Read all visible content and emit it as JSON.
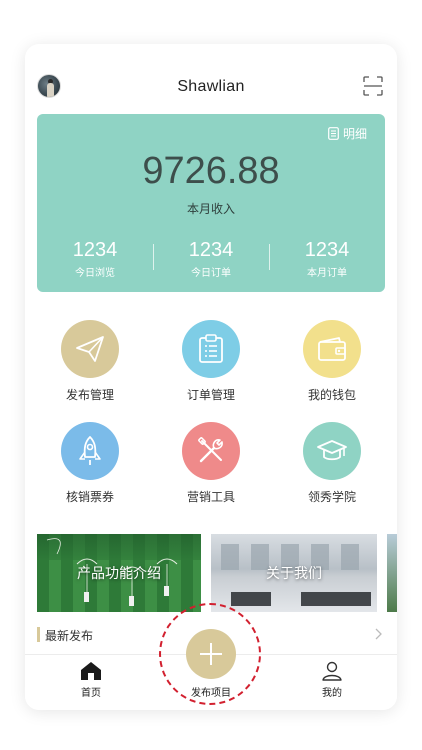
{
  "header": {
    "title": "Shawlian",
    "scan_icon": "scan-icon",
    "avatar_icon": "avatar"
  },
  "card": {
    "detail_label": "明细",
    "amount": "9726.88",
    "amount_label": "本月收入",
    "stats": [
      {
        "value": "1234",
        "label": "今日浏览"
      },
      {
        "value": "1234",
        "label": "今日订单"
      },
      {
        "value": "1234",
        "label": "本月订单"
      }
    ],
    "color": "#8fd3c4"
  },
  "grid": [
    {
      "label": "发布管理",
      "icon": "paper-plane-icon",
      "color": "#d8c99a"
    },
    {
      "label": "订单管理",
      "icon": "clipboard-icon",
      "color": "#7ecde6"
    },
    {
      "label": "我的钱包",
      "icon": "wallet-icon",
      "color": "#f2e08c"
    },
    {
      "label": "核销票券",
      "icon": "rocket-icon",
      "color": "#7bbbe9"
    },
    {
      "label": "营销工具",
      "icon": "tools-icon",
      "color": "#ef8a8a"
    },
    {
      "label": "领秀学院",
      "icon": "graduation-cap-icon",
      "color": "#8fd3c4"
    }
  ],
  "banners": [
    {
      "text": "产品功能介绍"
    },
    {
      "text": "关于我们"
    }
  ],
  "latest": {
    "title": "最新发布"
  },
  "tabbar": {
    "home": "首页",
    "publish": "发布项目",
    "me": "我的"
  },
  "colors": {
    "accent": "#d8c99a",
    "highlight_ring": "#d2202f"
  }
}
